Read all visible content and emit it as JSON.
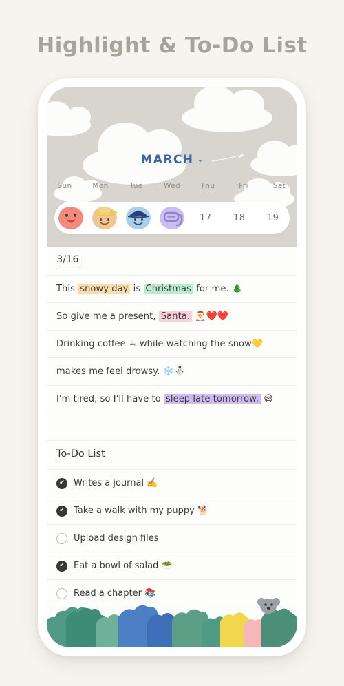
{
  "page": {
    "title": "Highlight & To-Do List",
    "background_color": "#F7F4EF",
    "title_color": "#A8A49C"
  },
  "calendar": {
    "month_label": "MARCH",
    "month_caret": "⌄",
    "month_color": "#3A67A8",
    "weekdays": [
      "Sun",
      "Mon",
      "Tue",
      "Wed",
      "Thu",
      "Fri",
      "Sat"
    ],
    "day_cells": [
      {
        "type": "sticker",
        "name": "sticker-face-smile-red",
        "color": "#F2897D"
      },
      {
        "type": "sticker",
        "name": "sticker-face-straw-hat",
        "color": "#F0C694"
      },
      {
        "type": "sticker",
        "name": "sticker-face-blue-cap",
        "color": "#A8D0E8"
      },
      {
        "type": "sticker",
        "name": "sticker-snorkel-mask",
        "color": "#BCB2EC"
      },
      {
        "type": "date",
        "label": "17"
      },
      {
        "type": "date",
        "label": "18"
      },
      {
        "type": "date",
        "label": "19"
      }
    ]
  },
  "journal": {
    "date_heading": "3/16",
    "lines": [
      {
        "id": "line-1",
        "segments": [
          {
            "text": "This ",
            "highlight": null
          },
          {
            "text": "snowy day",
            "highlight": "#FBDCAF"
          },
          {
            "text": " is ",
            "highlight": null
          },
          {
            "text": "Christmas",
            "highlight": "#BCEBD4"
          },
          {
            "text": " for me. 🎄",
            "highlight": null
          }
        ]
      },
      {
        "id": "line-2",
        "segments": [
          {
            "text": "So give me a present, ",
            "highlight": null
          },
          {
            "text": "Santa.",
            "highlight": "#FBCFDC"
          },
          {
            "text": " 🎅❤️❤️",
            "highlight": null
          }
        ]
      },
      {
        "id": "line-3",
        "segments": [
          {
            "text": "Drinking coffee ☕ while watching the snow💛",
            "highlight": null
          }
        ]
      },
      {
        "id": "line-4",
        "segments": [
          {
            "text": "makes me feel drowsy. ❄️⛄",
            "highlight": null
          }
        ]
      },
      {
        "id": "line-5",
        "segments": [
          {
            "text": "I'm tired, so I'll have to ",
            "highlight": null
          },
          {
            "text": "sleep late tomorrow.",
            "highlight": "#CDBCF0"
          },
          {
            "text": " 😪",
            "highlight": null
          }
        ]
      }
    ]
  },
  "todo": {
    "heading": "To-Do List",
    "items": [
      {
        "label": "Writes a journal ✍️",
        "done": true
      },
      {
        "label": "Take a walk with my puppy 🐕",
        "done": true
      },
      {
        "label": "Upload design files",
        "done": false
      },
      {
        "label": "Eat a bowl of salad 🥗",
        "done": true
      },
      {
        "label": "Read a chapter 📚",
        "done": false
      }
    ],
    "check_mark": "✔"
  },
  "forest": {
    "colors": [
      "#4F9A84",
      "#3E8C76",
      "#6FB09A",
      "#4C7FC4",
      "#3F6FB8",
      "#5D9E86",
      "#F2D64B",
      "#F5B7B8",
      "#4C8F79"
    ],
    "koala_color": "#9AA0A3"
  }
}
